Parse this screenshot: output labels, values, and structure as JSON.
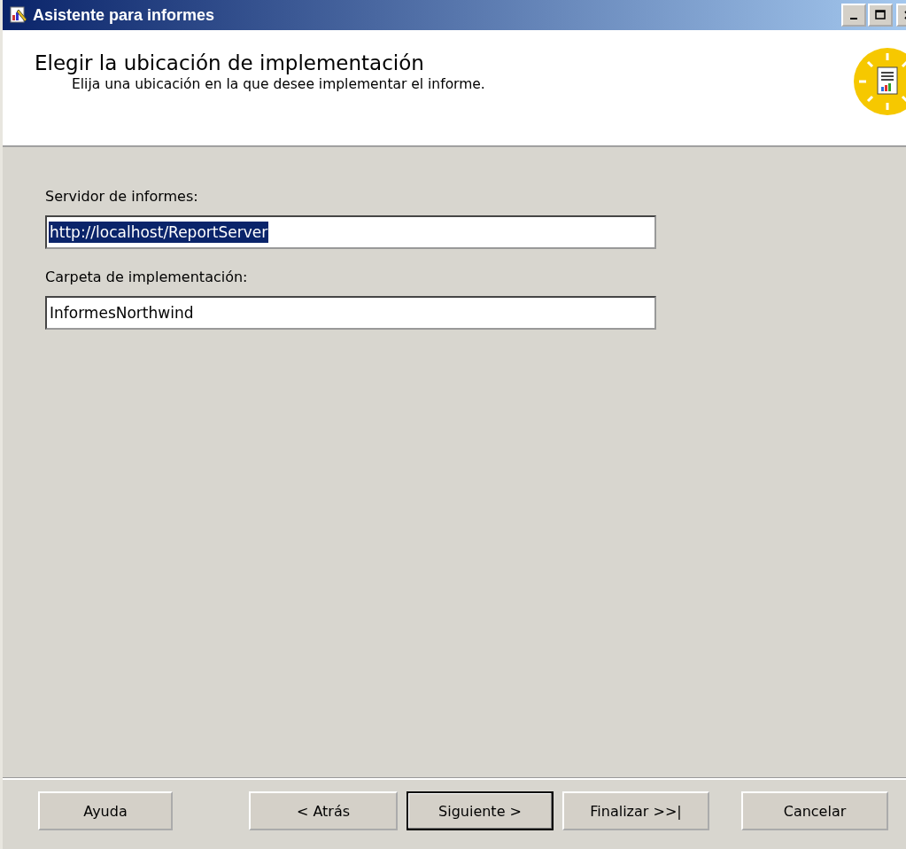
{
  "window": {
    "title": "Asistente para informes"
  },
  "header": {
    "title": "Elegir la ubicación de implementación",
    "subtitle": "Elija una ubicación en la que desee implementar el informe."
  },
  "fields": [
    {
      "label": "Servidor de informes:",
      "value": "http://localhost/ReportServer",
      "selected": true
    },
    {
      "label": "Carpeta de implementación:",
      "value": "InformesNorthwind",
      "selected": false
    }
  ],
  "buttons": [
    {
      "label": "Ayuda",
      "default": false
    },
    {
      "label": "< Atrás",
      "default": false
    },
    {
      "label": "Siguiente >",
      "default": true
    },
    {
      "label": "Finalizar >>|",
      "default": false
    },
    {
      "label": "Cancelar",
      "default": false
    }
  ]
}
